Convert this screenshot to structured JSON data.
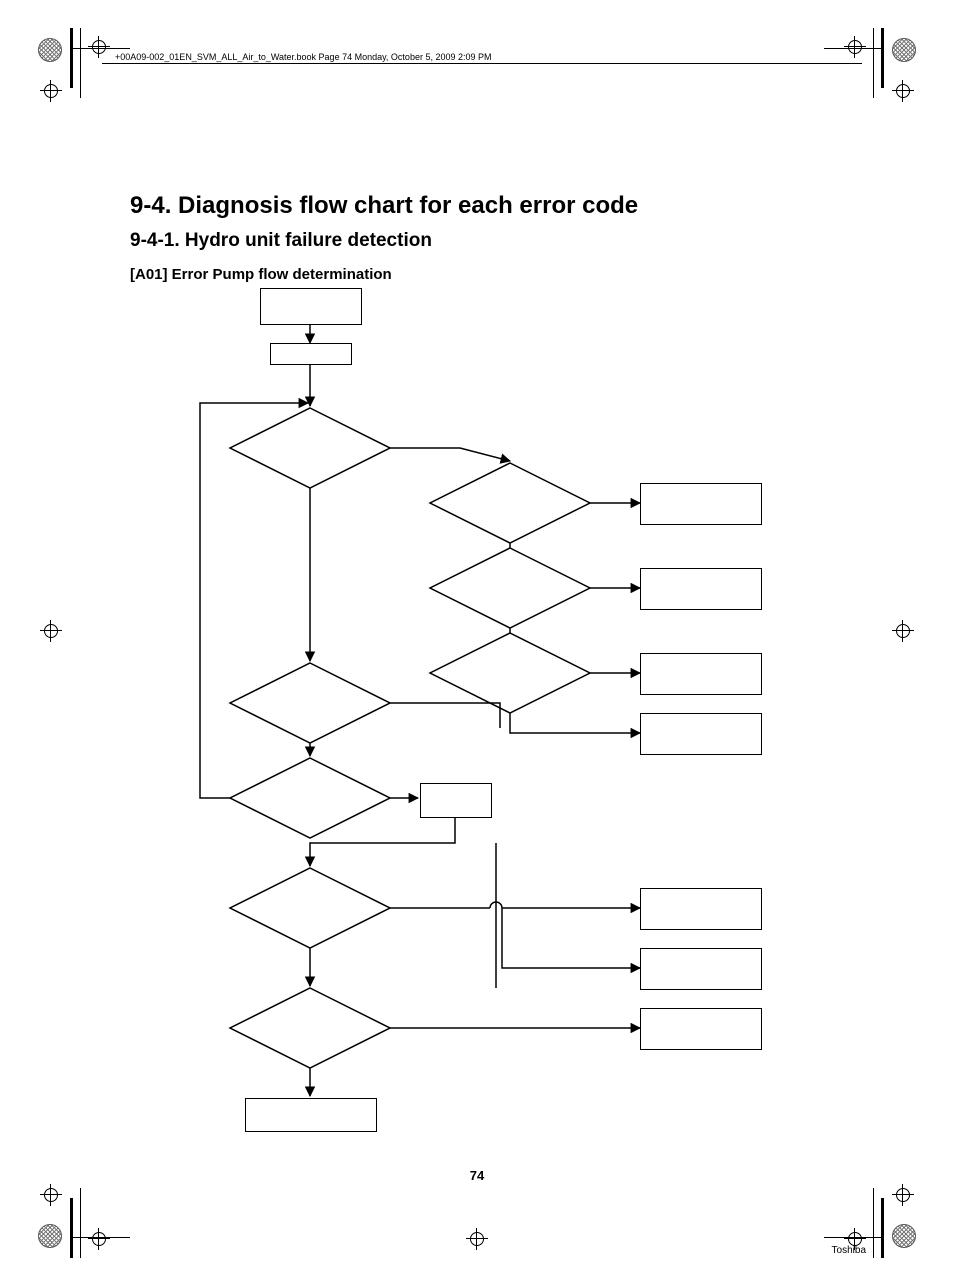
{
  "header": {
    "running_header": "+00A09-002_01EN_SVM_ALL_Air_to_Water.book  Page 74  Monday, October 5, 2009  2:09 PM"
  },
  "titles": {
    "section": "9-4.  Diagnosis flow chart for each error code",
    "subsection": "9-4-1.  Hydro unit failure detection",
    "item": "[A01] Error Pump flow determination"
  },
  "page_number": "74",
  "brand": "Toshiba",
  "chart_data": {
    "type": "flowchart",
    "nodes": [
      {
        "id": "n1",
        "shape": "rect",
        "label": ""
      },
      {
        "id": "n2",
        "shape": "rect",
        "label": ""
      },
      {
        "id": "d1",
        "shape": "diamond",
        "label": ""
      },
      {
        "id": "d2",
        "shape": "diamond",
        "label": ""
      },
      {
        "id": "r2",
        "shape": "rect",
        "label": ""
      },
      {
        "id": "d3",
        "shape": "diamond",
        "label": ""
      },
      {
        "id": "r3",
        "shape": "rect",
        "label": ""
      },
      {
        "id": "d4",
        "shape": "diamond",
        "label": ""
      },
      {
        "id": "r4",
        "shape": "rect",
        "label": ""
      },
      {
        "id": "d5",
        "shape": "diamond",
        "label": ""
      },
      {
        "id": "r5",
        "shape": "rect",
        "label": ""
      },
      {
        "id": "d6",
        "shape": "diamond",
        "label": ""
      },
      {
        "id": "n3",
        "shape": "rect",
        "label": ""
      },
      {
        "id": "d7",
        "shape": "diamond",
        "label": ""
      },
      {
        "id": "r7a",
        "shape": "rect",
        "label": ""
      },
      {
        "id": "r7b",
        "shape": "rect",
        "label": ""
      },
      {
        "id": "d8",
        "shape": "diamond",
        "label": ""
      },
      {
        "id": "r8",
        "shape": "rect",
        "label": ""
      },
      {
        "id": "nend",
        "shape": "rect",
        "label": ""
      }
    ],
    "edges": [
      {
        "from": "n1",
        "to": "n2"
      },
      {
        "from": "n2",
        "to": "d1"
      },
      {
        "from": "d1",
        "to": "d2",
        "label": ""
      },
      {
        "from": "d2",
        "to": "r2",
        "label": ""
      },
      {
        "from": "d2",
        "to": "d3",
        "label": ""
      },
      {
        "from": "d3",
        "to": "r3",
        "label": ""
      },
      {
        "from": "d3",
        "to": "d4",
        "label": ""
      },
      {
        "from": "d4",
        "to": "r4",
        "label": ""
      },
      {
        "from": "d1",
        "to": "d5",
        "label": ""
      },
      {
        "from": "d5",
        "to": "r5",
        "label": ""
      },
      {
        "from": "d5",
        "to": "d6",
        "label": ""
      },
      {
        "from": "d6",
        "to": "n3",
        "label": ""
      },
      {
        "from": "n3",
        "to": "d7"
      },
      {
        "from": "d7",
        "to": "r7a",
        "label": ""
      },
      {
        "from": "d7",
        "to": "r7b",
        "label": ""
      },
      {
        "from": "d7",
        "to": "d8",
        "label": ""
      },
      {
        "from": "d8",
        "to": "r8",
        "label": ""
      },
      {
        "from": "d8",
        "to": "nend",
        "label": ""
      },
      {
        "from": "d6",
        "to": "d1",
        "label": "loop-back"
      }
    ]
  }
}
